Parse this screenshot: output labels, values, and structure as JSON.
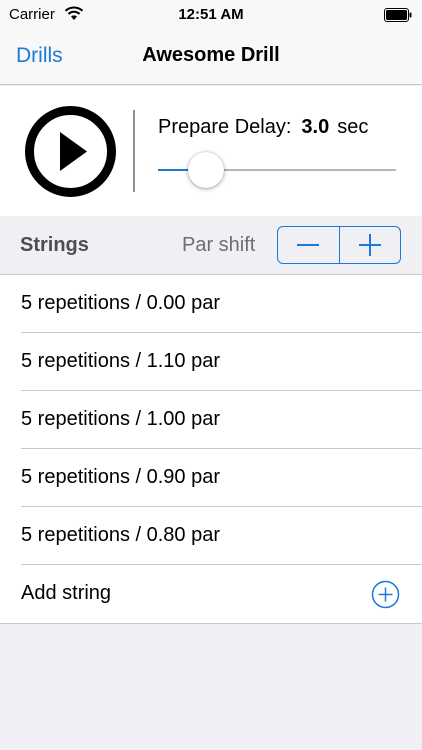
{
  "status_bar": {
    "carrier": "Carrier",
    "time": "12:51 AM",
    "icons": [
      "wifi-icon",
      "battery-icon"
    ]
  },
  "nav": {
    "back_label": "Drills",
    "title": "Awesome Drill"
  },
  "prepare": {
    "label": "Prepare Delay:",
    "value": "3.0",
    "unit": "sec",
    "slider_fraction": 0.2
  },
  "strings_section": {
    "title": "Strings",
    "par_shift_label": "Par shift",
    "stepper_icons": [
      "minus-icon",
      "plus-icon"
    ]
  },
  "strings": [
    {
      "label": "5 repetitions / 0.00 par"
    },
    {
      "label": "5 repetitions / 1.10 par"
    },
    {
      "label": "5 repetitions / 1.00 par"
    },
    {
      "label": "5 repetitions / 0.90 par"
    },
    {
      "label": "5 repetitions / 0.80 par"
    }
  ],
  "add_string": {
    "label": "Add string",
    "icon": "add-circle-icon"
  },
  "colors": {
    "accent": "#1a7ad9",
    "background": "#efeff4",
    "separator": "#c8c7cc"
  }
}
